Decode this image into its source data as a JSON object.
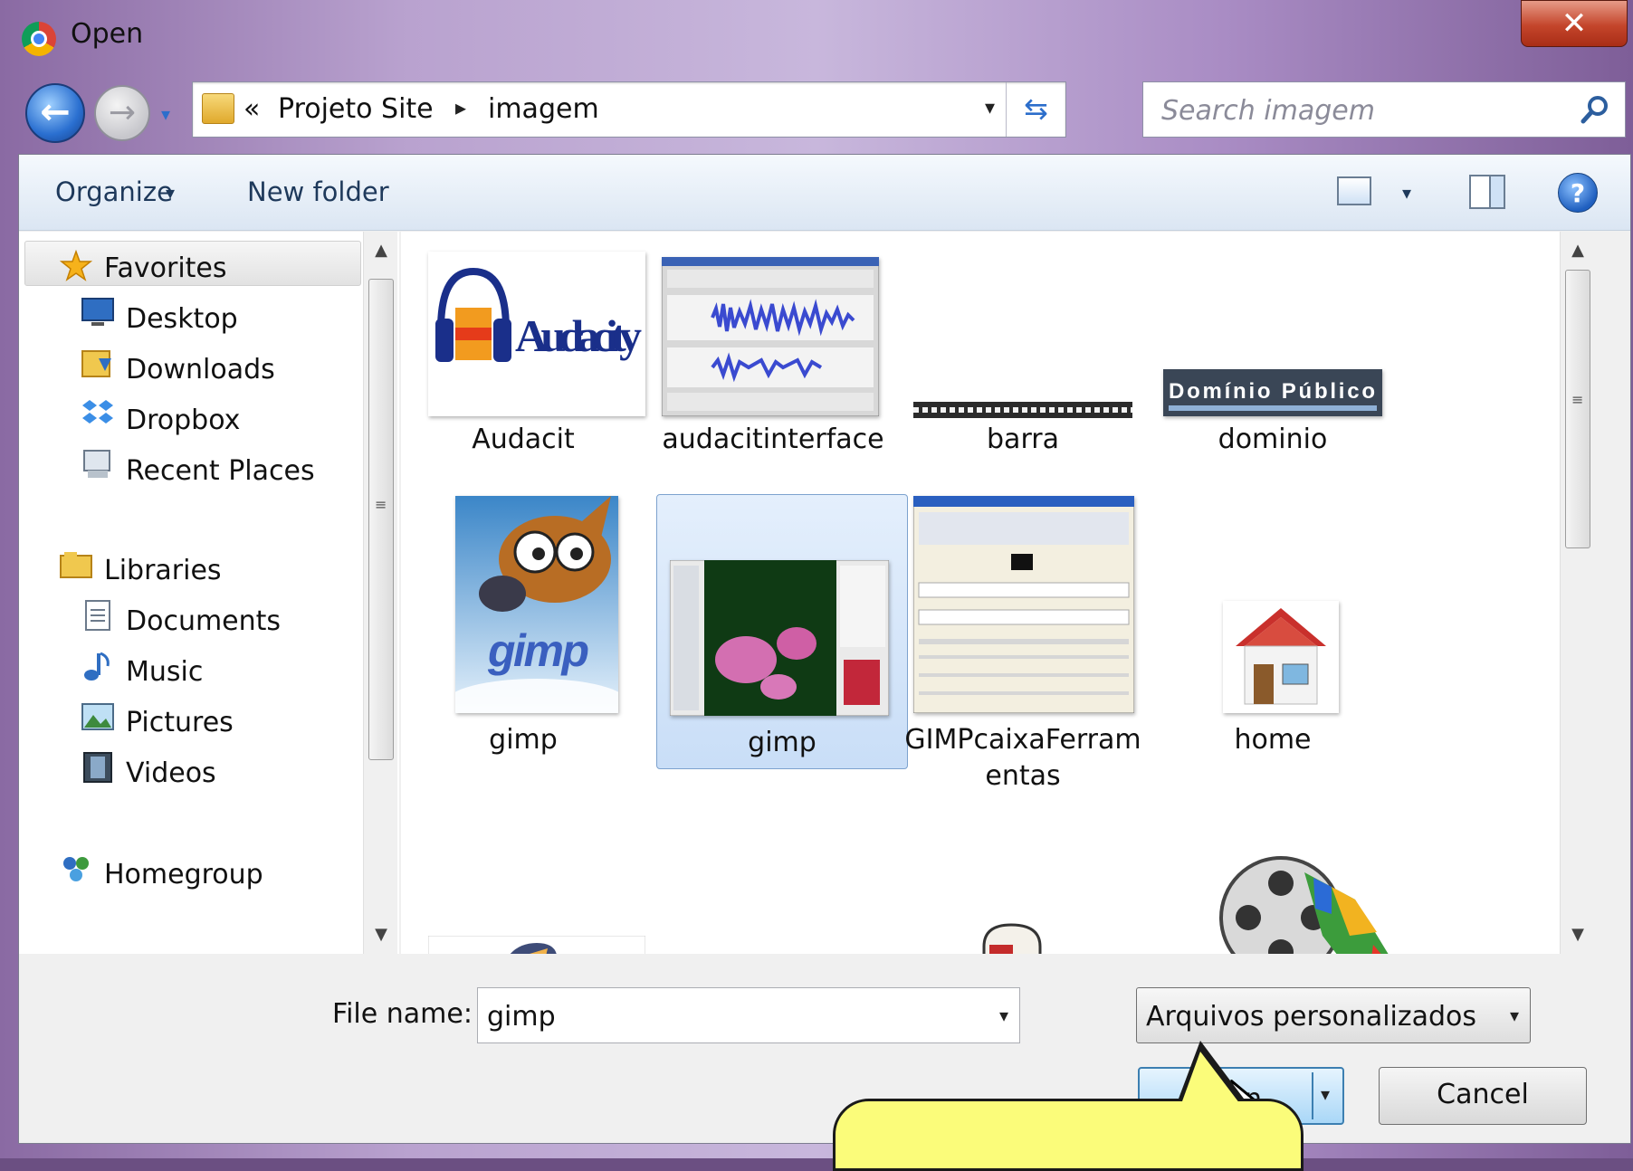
{
  "window": {
    "title": "Open",
    "close_glyph": "✕"
  },
  "nav": {
    "back_glyph": "←",
    "forward_glyph": "→",
    "breadcrumb": {
      "overflow": "«",
      "items": [
        "Projeto Site",
        "imagem"
      ],
      "separator": "▸"
    },
    "search_placeholder": "Search imagem",
    "dropdown_glyph": "▾",
    "refresh_glyph": "⇆"
  },
  "toolbar": {
    "organize": "Organize",
    "new_folder": "New folder",
    "help": "?"
  },
  "sidebar": {
    "favorites": "Favorites",
    "favorites_items": [
      "Desktop",
      "Downloads",
      "Dropbox",
      "Recent Places"
    ],
    "libraries": "Libraries",
    "libraries_items": [
      "Documents",
      "Music",
      "Pictures",
      "Videos"
    ],
    "homegroup": "Homegroup"
  },
  "files": [
    {
      "name": "Audacit",
      "thumb_text": "Audacity",
      "icon": "audacity-logo-icon"
    },
    {
      "name": "audacitinterface",
      "icon": "audacity-screenshot-icon"
    },
    {
      "name": "barra",
      "icon": "barra-image-icon"
    },
    {
      "name": "dominio",
      "thumb_text": "Domínio Público",
      "icon": "dominio-publico-icon"
    },
    {
      "name": "gimp",
      "thumb_text": "gimp",
      "icon": "gimp-logo-icon"
    },
    {
      "name": "gimp",
      "icon": "gimp-screenshot-icon",
      "selected": true
    },
    {
      "name": "GIMPcaixaFerramentas",
      "line1": "GIMPcaixaFerram",
      "line2": "entas",
      "icon": "gimp-toolbox-icon"
    },
    {
      "name": "home",
      "icon": "home-icon"
    }
  ],
  "bottom": {
    "file_name_label": "File name:",
    "file_name_value": "gimp",
    "file_type_value": "Arquivos personalizados",
    "open_label": "Open",
    "cancel_label": "Cancel"
  },
  "colors": {
    "accent": "#2c6ecb",
    "selection": "#c9def7",
    "callout": "#fbfc7a"
  }
}
